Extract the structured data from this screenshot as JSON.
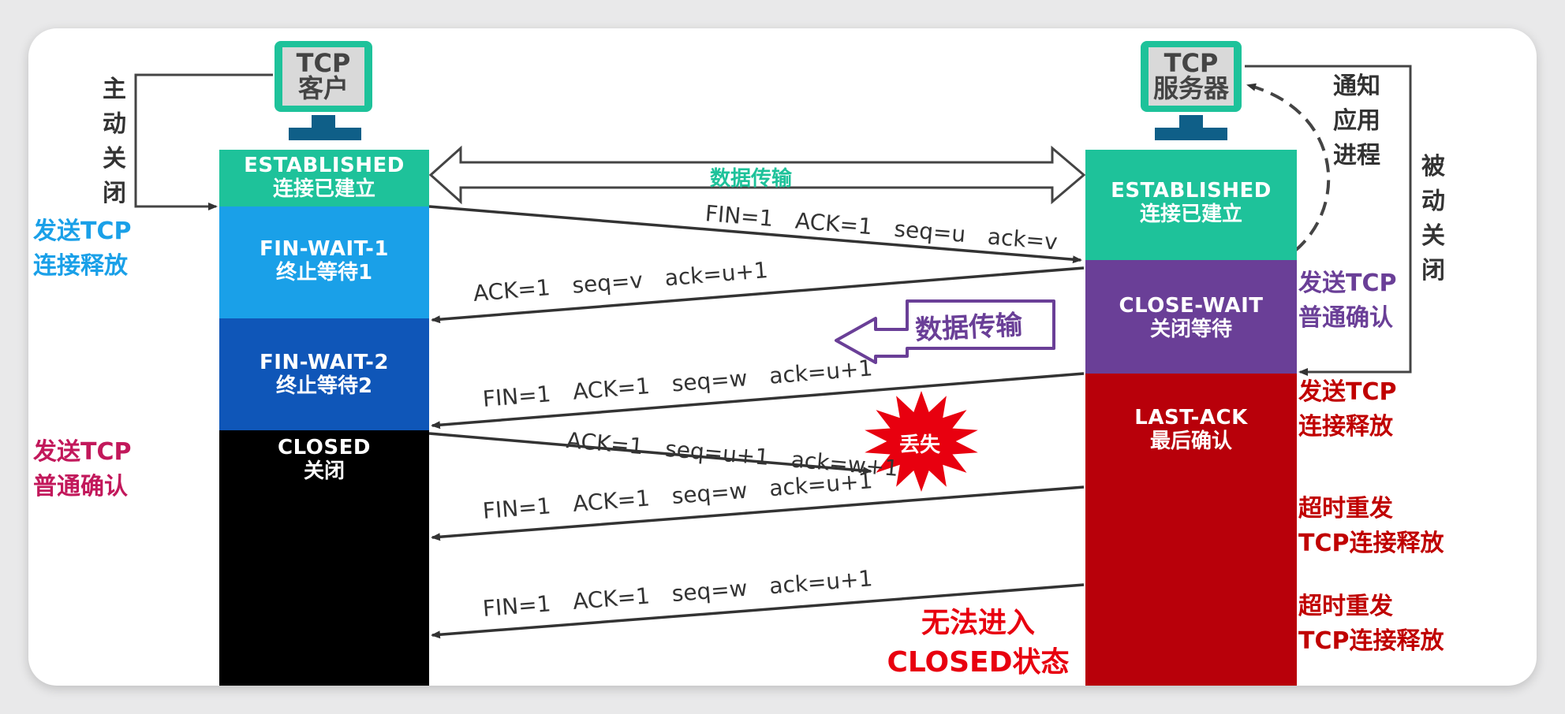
{
  "client": {
    "title": "TCP客户",
    "title_line1": "TCP",
    "title_line2": "客户",
    "states": [
      {
        "en": "ESTABLISHED",
        "zh": "连接已建立",
        "color": "#1ec29a"
      },
      {
        "en": "FIN-WAIT-1",
        "zh": "终止等待1",
        "color": "#1aa0e8"
      },
      {
        "en": "FIN-WAIT-2",
        "zh": "终止等待2",
        "color": "#0f56b8"
      },
      {
        "en": "CLOSED",
        "zh": "关闭",
        "color": "#000000"
      }
    ],
    "active_close": "主动关闭",
    "active_close_chars": [
      "主",
      "动",
      "关",
      "闭"
    ]
  },
  "server": {
    "title": "TCP服务器",
    "title_line1": "TCP",
    "title_line2": "服务器",
    "states": [
      {
        "en": "ESTABLISHED",
        "zh": "连接已建立",
        "color": "#1ec29a"
      },
      {
        "en": "CLOSE-WAIT",
        "zh": "关闭等待",
        "color": "#6a3f97"
      },
      {
        "en": "LAST-ACK",
        "zh": "最后确认",
        "color": "#b8000a"
      }
    ],
    "notify_chars": [
      "通",
      "知",
      "应",
      "用",
      "进",
      "程"
    ],
    "notify_lines": [
      "通知",
      "应用",
      "进程"
    ],
    "passive_close_chars": [
      "被",
      "动",
      "关",
      "闭"
    ]
  },
  "left_labels": [
    {
      "lines": [
        "发送TCP",
        "连接释放"
      ],
      "color": "#1aa0e8"
    },
    {
      "lines": [
        "发送TCP",
        "普通确认"
      ],
      "color": "#c2185b"
    }
  ],
  "right_labels": [
    {
      "lines": [
        "发送TCP",
        "普通确认"
      ],
      "color": "#6a3f97"
    },
    {
      "lines": [
        "发送TCP",
        "连接释放"
      ],
      "color": "#c00000"
    },
    {
      "lines": [
        "超时重发",
        "TCP连接释放"
      ],
      "color": "#c00000"
    },
    {
      "lines": [
        "超时重发",
        "TCP连接释放"
      ],
      "color": "#c00000"
    }
  ],
  "data_transfer_label": "数据传输",
  "data_transfer_callout": "数据传输",
  "lost_label": "丢失",
  "cannot_enter": [
    "无法进入",
    "CLOSED状态"
  ],
  "messages": [
    {
      "parts": [
        "FIN=1",
        "ACK=1",
        "seq=u",
        "ack=v"
      ]
    },
    {
      "parts": [
        "ACK=1",
        "seq=v",
        "ack=u+1"
      ]
    },
    {
      "parts": [
        "FIN=1",
        "ACK=1",
        "seq=w",
        "ack=u+1"
      ]
    },
    {
      "parts": [
        "ACK=1",
        "seq=u+1",
        "ack=w+1"
      ]
    },
    {
      "parts": [
        "FIN=1",
        "ACK=1",
        "seq=w",
        "ack=u+1"
      ]
    },
    {
      "parts": [
        "FIN=1",
        "ACK=1",
        "seq=w",
        "ack=u+1"
      ]
    }
  ]
}
